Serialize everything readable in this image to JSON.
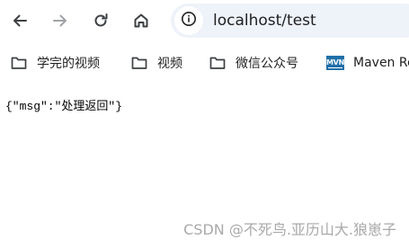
{
  "toolbar": {
    "url": "localhost/test",
    "icons": {
      "back": "arrow-left-icon",
      "forward": "arrow-right-icon",
      "reload": "reload-icon",
      "home": "home-icon",
      "site_info": "info-icon"
    }
  },
  "bookmarks": [
    {
      "label": "学完的视频",
      "icon": "folder-icon"
    },
    {
      "label": "视频",
      "icon": "folder-icon"
    },
    {
      "label": "微信公众号",
      "icon": "folder-icon"
    },
    {
      "label": "Maven Re",
      "icon": "maven-favicon",
      "badge": "MVN"
    }
  ],
  "page": {
    "body_text": "{\"msg\":\"处理返回\"}"
  },
  "watermark": "CSDN @不死鸟.亚历山大.狼崽子",
  "colors": {
    "omnibox_bg": "#eef2f9",
    "icon": "#3c4043",
    "icon_disabled": "#a0a4a8",
    "maven_badge": "#1f6fa8",
    "watermark": "#8c8c8c"
  }
}
